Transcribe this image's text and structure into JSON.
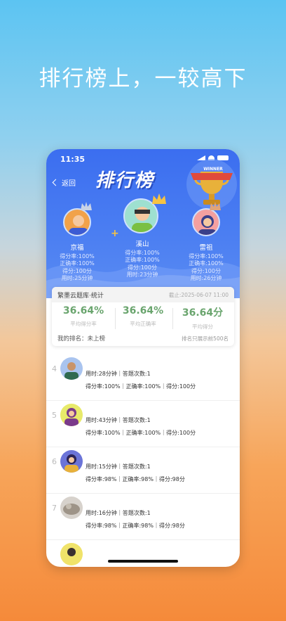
{
  "headline": "排行榜上，一较高下",
  "phone": {
    "status_time": "11:35",
    "back_label": "返回",
    "title": "排行榜",
    "trophy_label": "WINNER",
    "podium": [
      {
        "name": "京福",
        "score_rate": "得分率:100%",
        "correct_rate": "正确率:100%",
        "score": "得分:100分",
        "time": "用时:25分钟"
      },
      {
        "name": "溪山",
        "score_rate": "得分率:100%",
        "correct_rate": "正确率:100%",
        "score": "得分:100分",
        "time": "用时:23分钟"
      },
      {
        "name": "雷祖",
        "score_rate": "得分率:100%",
        "correct_rate": "正确率:100%",
        "score": "得分:100分",
        "time": "用时:26分钟"
      }
    ],
    "stats": {
      "title": "繁墨云题库·统计",
      "date": "截止:2025-06-07 11:00",
      "metrics": [
        {
          "value": "36.64%",
          "label": "平均得分率"
        },
        {
          "value": "36.64%",
          "label": "平均正确率"
        },
        {
          "value": "36.64分",
          "label": "平均得分"
        }
      ],
      "my_rank": "我的排名：未上榜",
      "note": "排名只展示前500名"
    },
    "rows": [
      {
        "rank": "4",
        "line1": "用时:28分钟｜答题次数:1",
        "line2": "得分率:100%｜正确率:100%｜得分:100分"
      },
      {
        "rank": "5",
        "line1": "用时:43分钟｜答题次数:1",
        "line2": "得分率:100%｜正确率:100%｜得分:100分"
      },
      {
        "rank": "6",
        "line1": "用时:15分钟｜答题次数:1",
        "line2": "得分率:98%｜正确率:98%｜得分:98分"
      },
      {
        "rank": "7",
        "line1": "用时:16分钟｜答题次数:1",
        "line2": "得分率:98%｜正确率:98%｜得分:98分"
      }
    ]
  },
  "colors": {
    "hero_blue": "#3b6ef0",
    "metric_green": "#6aa56e",
    "crown_gold": "#f6c343"
  }
}
